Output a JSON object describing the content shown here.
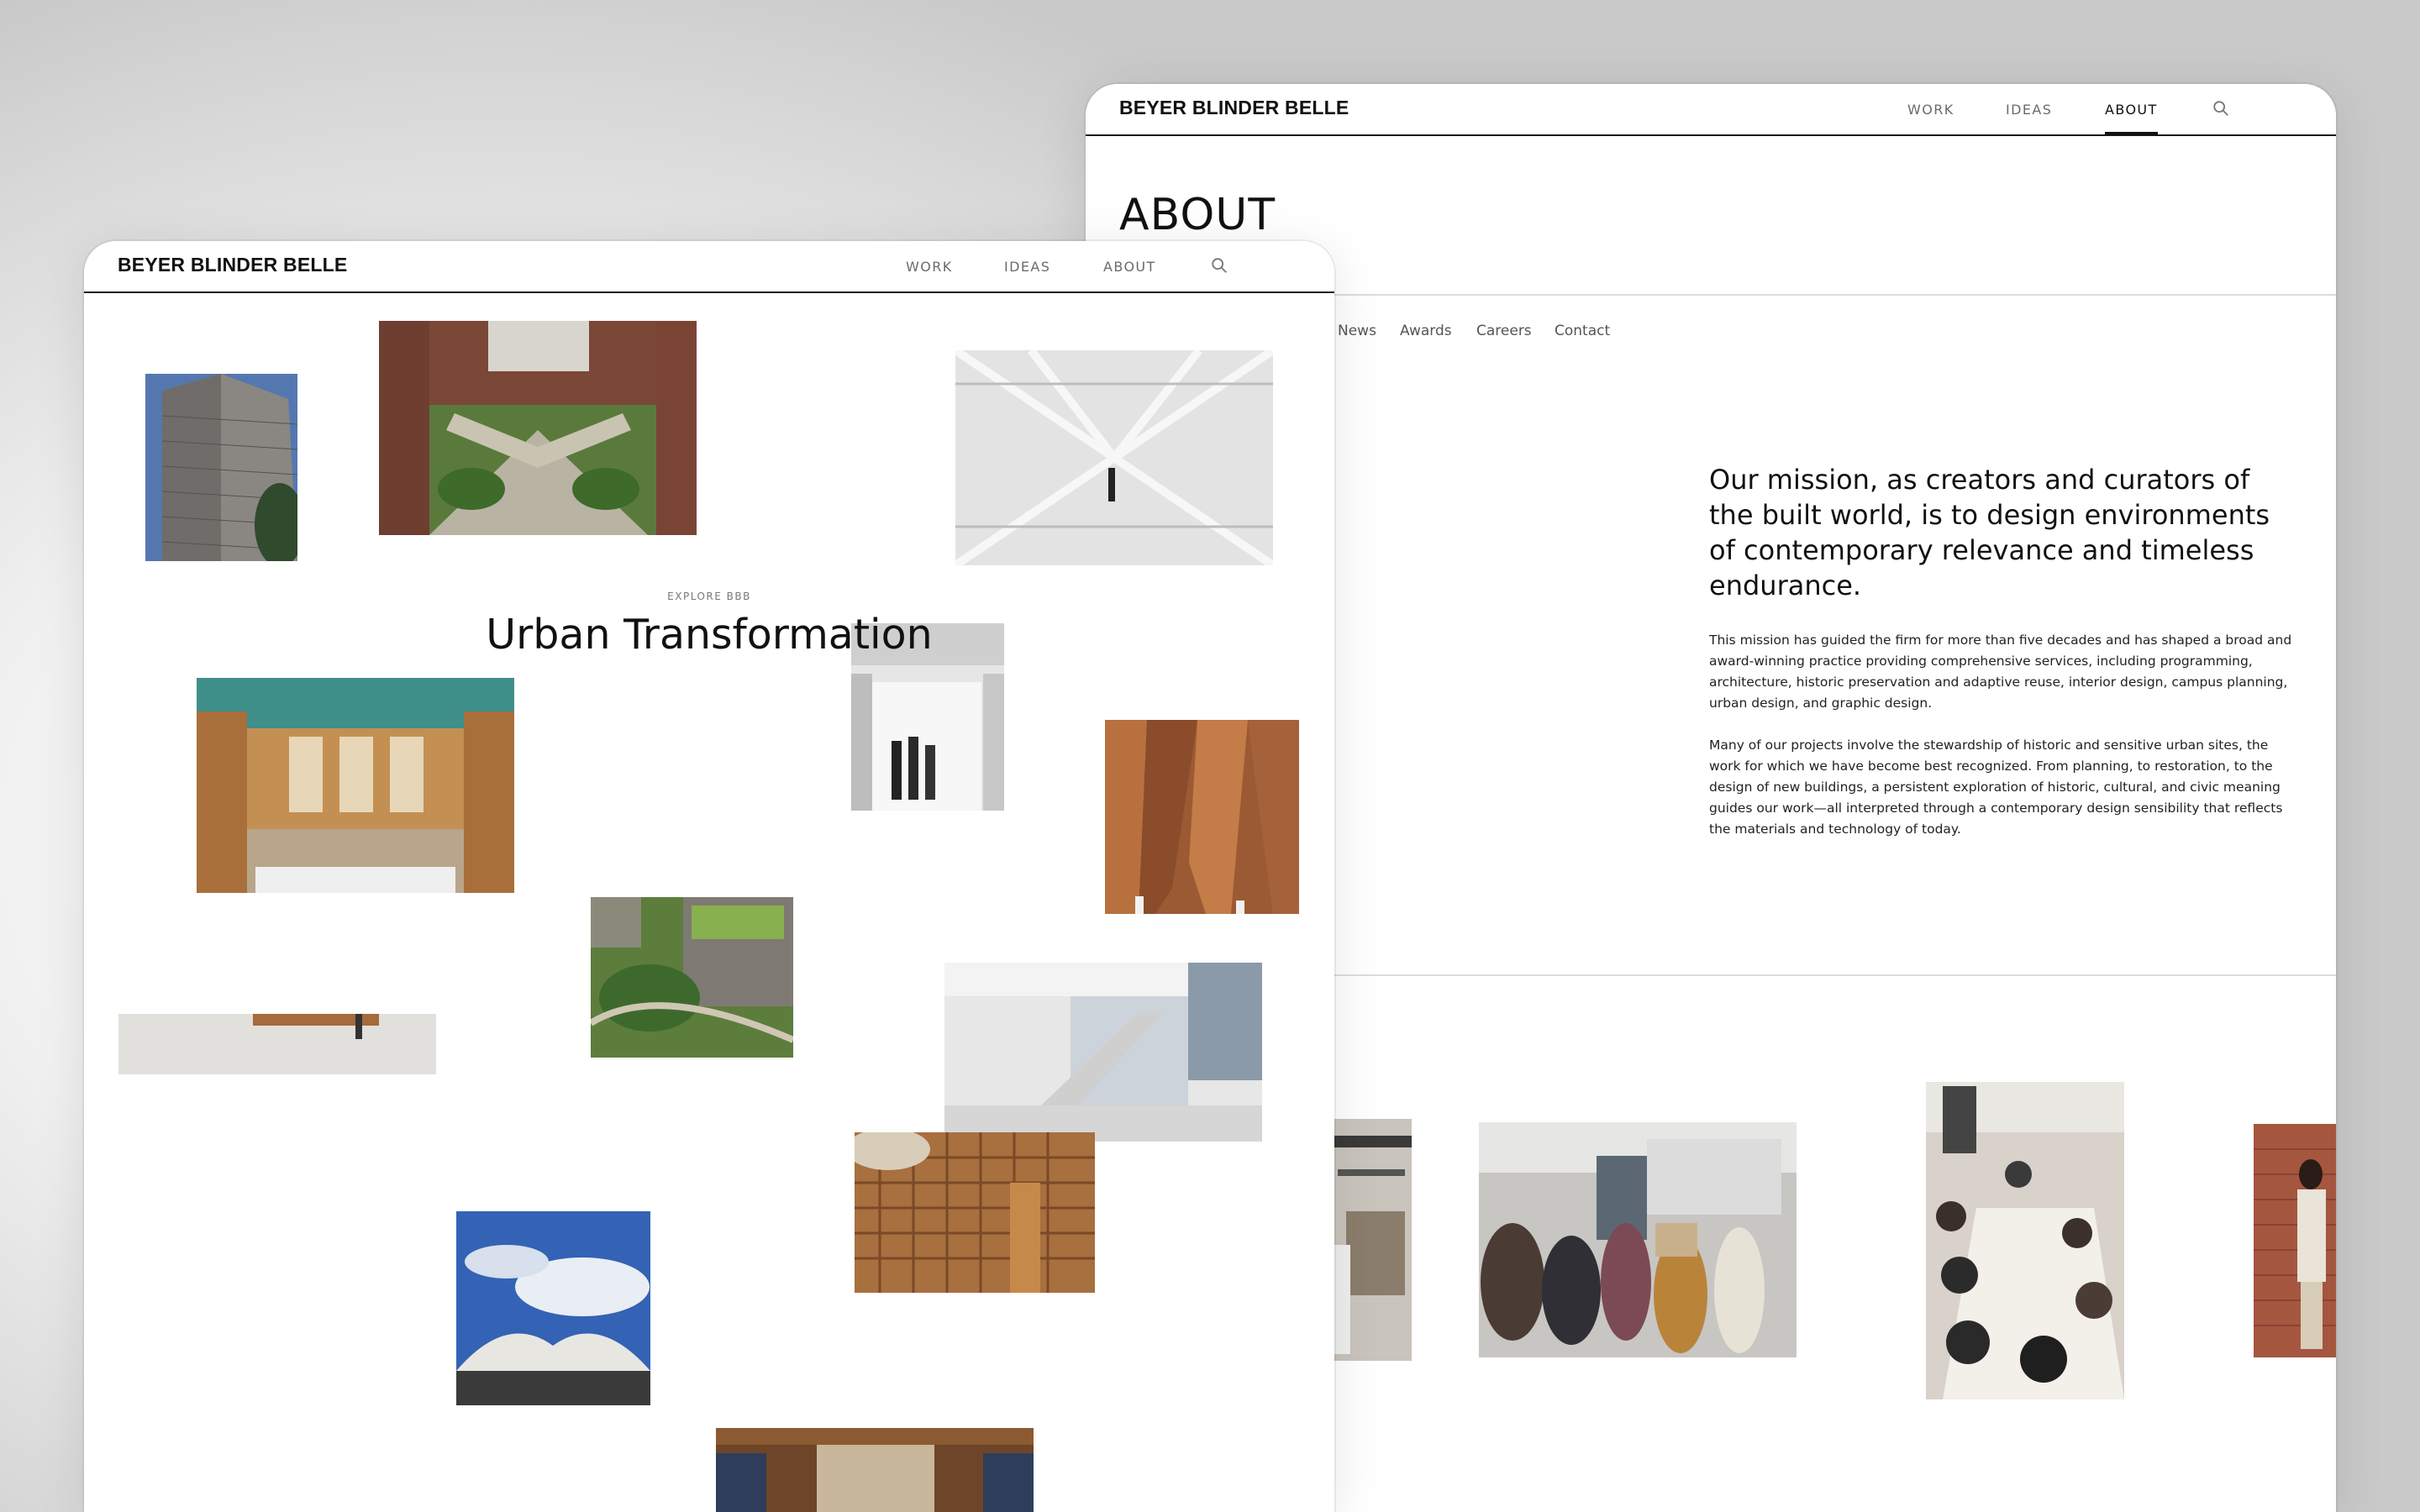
{
  "brand": "BEYER BLINDER BELLE",
  "nav": [
    "WORK",
    "IDEAS",
    "ABOUT"
  ],
  "home": {
    "eyebrow": "EXPLORE BBB",
    "headline": "Urban Transformation"
  },
  "about": {
    "page_title": "ABOUT",
    "subnav": [
      "News",
      "Awards",
      "Careers",
      "Contact"
    ],
    "mission": "Our mission, as creators and curators of the built world, is to design environments of contemporary relevance and timeless endurance.",
    "paragraph1": "This mission has guided the firm for more than five decades and has shaped a broad and award-winning practice providing comprehensive services, including programming, architecture, historic preservation and adaptive reuse, interior design, campus planning, urban design, and graphic design.",
    "paragraph2": "Many of our projects involve the stewardship of historic and sensitive urban sites, the work for which we have become best recognized. From planning, to restoration, to the design of new buildings, a persistent exploration of historic, cultural, and civic meaning guides our work—all interpreted through a contemporary design sensibility that reflects the materials and technology of today."
  },
  "colors": {
    "ink": "#111111",
    "muted": "#6b6b6b",
    "divider": "#dcdcdc"
  }
}
